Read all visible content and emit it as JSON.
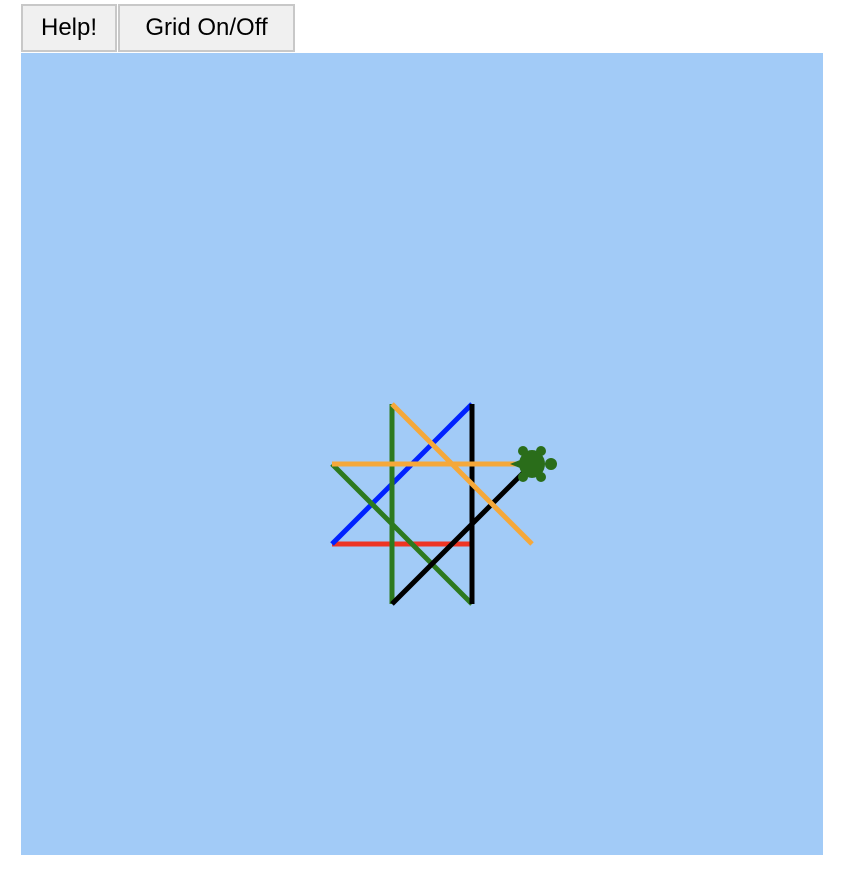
{
  "toolbar": {
    "help_label": "Help!",
    "grid_label": "Grid On/Off"
  },
  "canvas": {
    "background": "#a2cbf7",
    "grid_visible": false
  },
  "drawing": {
    "segments": [
      {
        "color": "#ee3524",
        "from": [
          -90,
          -90
        ],
        "to": [
          -30,
          -90
        ]
      },
      {
        "color": "#ee3524",
        "from": [
          -30,
          -90
        ],
        "to": [
          50,
          -90
        ]
      },
      {
        "color": "#0022ff",
        "from": [
          -90,
          -90
        ],
        "to": [
          50,
          50
        ]
      },
      {
        "color": "#2d7a1f",
        "from": [
          -30,
          -150
        ],
        "to": [
          -30,
          50
        ]
      },
      {
        "color": "#2d7a1f",
        "from": [
          -90,
          -10
        ],
        "to": [
          50,
          -150
        ]
      },
      {
        "color": "#000000",
        "from": [
          -30,
          -150
        ],
        "to": [
          110,
          -10
        ]
      },
      {
        "color": "#000000",
        "from": [
          50,
          -150
        ],
        "to": [
          50,
          50
        ]
      },
      {
        "color": "#f5a83a",
        "from": [
          110,
          -90
        ],
        "to": [
          -30,
          50
        ]
      },
      {
        "color": "#f5a83a",
        "from": [
          -90,
          -10
        ],
        "to": [
          110,
          -10
        ]
      }
    ],
    "turtle": {
      "position": [
        110,
        -10
      ],
      "heading_deg": 0,
      "color": "#2a6d1a"
    }
  }
}
